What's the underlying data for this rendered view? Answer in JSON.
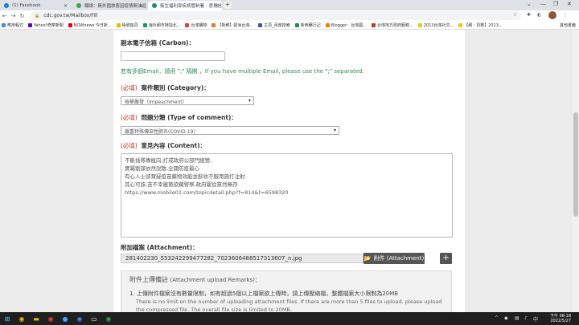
{
  "browser": {
    "tabs": [
      {
        "label": "(1) Facebook",
        "color": "#1877f2"
      },
      {
        "label": "鐵總：無外國旅客因疫情無法返國...",
        "color": "#34a853"
      },
      {
        "label": "衛生福利部疾病管制署 - 意見信箱",
        "color": "#1a8f5a"
      }
    ],
    "address": "cdc.gov.tw/Mailbox/Fill",
    "bookmarks": [
      "應用程式",
      "Yahoo!奇摩新聞",
      "NOWnews 今日新...",
      "帳號首頁",
      "海外網市場指北...",
      "台灣購物",
      "【新鮮】歐洲台灣...",
      "主頁_百度搜索",
      "新西蘭行記",
      "Blogger：台灣國...",
      "台灣地方政府服務...",
      "2013台灣社交...",
      "【網・頁數】2013..."
    ],
    "bookmarks_right": "其他書籤"
  },
  "form": {
    "carbon_label": "副本電子信箱 (Carbon)：",
    "carbon_value": "",
    "carbon_hint": "若有多個Email，請用 \";\" 隔開 ，If you have multiple Email, please use the \";\" separated.",
    "required": "(必填)",
    "category_label": "案件類別 (Category)：",
    "category_value": "檢舉嚴發（Impeachment）",
    "type_label": "問題分類 (Type of comment)：",
    "type_value": "嚴重特殊傳染性肺炎(COVID-19)",
    "content_label": "意見內容 (Content)：",
    "content_lines": [
      "不斷插隊專瘋向,打戒政府公部門經營,",
      "實屬劉謀依然說散,全國防疫最心",
      "有心人士卻賞疑疫苗藥物效能並辭收不服用施打注射",
      "其心可誅,苦不幸嚴懲欲藏警察,政府罷從黨然無存",
      "https://www.mobile01.com/topicdetail.php?f=814&t=6598320"
    ],
    "attach_label": "附加檔案 (Attachment)：",
    "attach_file": "281402230_553242299477282_7023606488517313607_n.jpg",
    "attach_button": "附件 (Attachment)",
    "plus_button": "+",
    "remarks_title": "附件上傳備註",
    "remarks_title_en": "(Attachment upload Remarks)：",
    "remarks_line": "1. 上傳附件檔案沒有數量限制，如有超過5個以上檔案欲上傳時，請上傳壓縮檔，整體檔案大小限制為20MB",
    "remarks_en1": "There is no limit on the number of uploading attachment files. If there are more than 5 files to upload, please upload",
    "remarks_en2": "the compressed file. The overall file size is limited to 20MB."
  },
  "taskbar": {
    "time": "下午 08:18",
    "date": "2022/5/27"
  }
}
